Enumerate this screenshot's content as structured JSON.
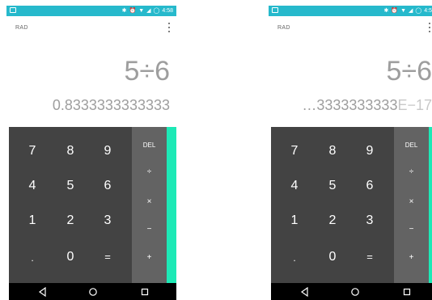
{
  "screens": [
    {
      "status_bar": {
        "time": "4:58",
        "icons": [
          "sim-card-icon",
          "bluetooth-icon",
          "alarm-icon",
          "wifi-icon",
          "signal-icon",
          "battery-icon"
        ]
      },
      "app_bar": {
        "mode_label": "RAD",
        "menu_icon": "overflow-menu-icon"
      },
      "display": {
        "formula": "5÷6",
        "result": "0.8333333333333",
        "result_faded": ""
      },
      "keypad": {
        "digits": [
          "7",
          "8",
          "9",
          "4",
          "5",
          "6",
          "1",
          "2",
          "3",
          ".",
          "0",
          "="
        ],
        "operators": [
          "DEL",
          "÷",
          "×",
          "−",
          "+"
        ],
        "colors": {
          "numpad": "#434343",
          "operators": "#636363",
          "drawer": "#1de9b6"
        }
      },
      "nav_bar": {
        "icons": [
          "back-icon",
          "home-icon",
          "recents-icon"
        ]
      }
    },
    {
      "status_bar": {
        "time": "4:5",
        "icons": [
          "sim-card-icon",
          "bluetooth-icon",
          "alarm-icon",
          "wifi-icon",
          "signal-icon",
          "battery-icon"
        ]
      },
      "app_bar": {
        "mode_label": "RAD",
        "menu_icon": "overflow-menu-icon"
      },
      "display": {
        "formula": "5÷6",
        "result": "…3333333333",
        "result_faded": "E−17"
      },
      "keypad": {
        "digits": [
          "7",
          "8",
          "9",
          "4",
          "5",
          "6",
          "1",
          "2",
          "3",
          ".",
          "0",
          "="
        ],
        "operators": [
          "DEL",
          "÷",
          "×",
          "−",
          "+"
        ],
        "colors": {
          "numpad": "#434343",
          "operators": "#636363",
          "drawer": "#1de9b6"
        }
      },
      "nav_bar": {
        "icons": [
          "back-icon",
          "home-icon",
          "recents-icon"
        ]
      }
    }
  ],
  "theme": {
    "status_bar": "#26b9cc",
    "display_text": "#9e9e9e"
  }
}
